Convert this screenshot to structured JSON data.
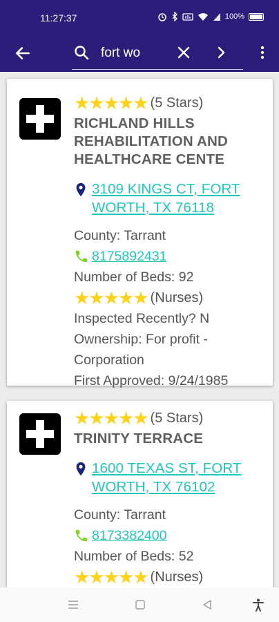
{
  "status": {
    "time": "11:27:37",
    "battery": "100%"
  },
  "search": {
    "query": "fort wo"
  },
  "facilities": [
    {
      "stars": "★★★★★",
      "rating_label": "(5 Stars)",
      "name": "RICHLAND HILLS REHABILITATION AND HEALTHCARE CENTE",
      "address": "3109 KINGS CT, FORT WORTH, TX 76118",
      "county": "County: Tarrant",
      "phone": "8175892431",
      "beds": "Number of Beds: 92",
      "nurse_stars": "★★★★★",
      "nurse_label": "(Nurses)",
      "inspected": "Inspected Recently? N",
      "ownership": "Ownership: For profit - Corporation",
      "approved": "First Approved: 9/24/1985"
    },
    {
      "stars": "★★★★★",
      "rating_label": "(5 Stars)",
      "name": "TRINITY TERRACE",
      "address": "1600 TEXAS ST, FORT WORTH, TX 76102",
      "county": "County: Tarrant",
      "phone": "8173382400",
      "beds": "Number of Beds: 52",
      "nurse_stars": "★★★★★",
      "nurse_label": "(Nurses)"
    }
  ],
  "colors": {
    "appbar": "#2a1e7a",
    "link": "#20c7bd",
    "star": "#ffd21a",
    "pin": "#1a237e",
    "phone_icon": "#7ed321"
  },
  "icons": [
    "back-arrow-icon",
    "search-icon",
    "clear-icon",
    "forward-icon",
    "more-vert-icon",
    "medical-cross-icon",
    "location-pin-icon",
    "phone-icon"
  ]
}
